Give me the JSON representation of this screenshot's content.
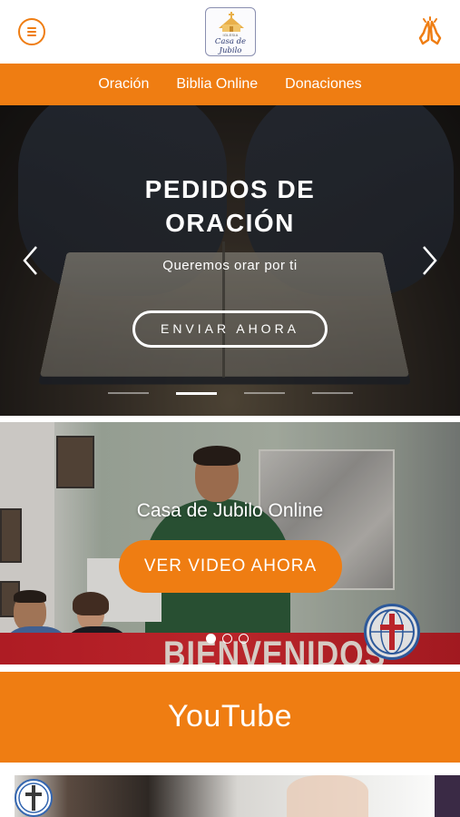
{
  "header": {
    "menu_icon": "hamburger-icon",
    "logo": {
      "small_text": "IGLESIA",
      "script_text": "Casa de Jubilo"
    },
    "pray_icon": "praying-hands-icon"
  },
  "nav": {
    "items": [
      {
        "label": "Oración"
      },
      {
        "label": "Biblia Online"
      },
      {
        "label": "Donaciones"
      }
    ]
  },
  "hero": {
    "title": "PEDIDOS DE\nORACIÓN",
    "subtitle": "Queremos orar por ti",
    "button_label": "ENVIAR AHORA",
    "prev_icon": "chevron-left-icon",
    "next_icon": "chevron-right-icon",
    "slide_count": 4,
    "active_slide": 2
  },
  "video": {
    "title": "Casa de Jubilo Online",
    "button_label": "VER VIDEO AHORA",
    "banner_text": "BIENVENIDOS",
    "slide_count": 3,
    "active_slide": 1
  },
  "youtube": {
    "label": "YouTube"
  },
  "colors": {
    "accent": "#ef7d12",
    "white": "#ffffff"
  }
}
